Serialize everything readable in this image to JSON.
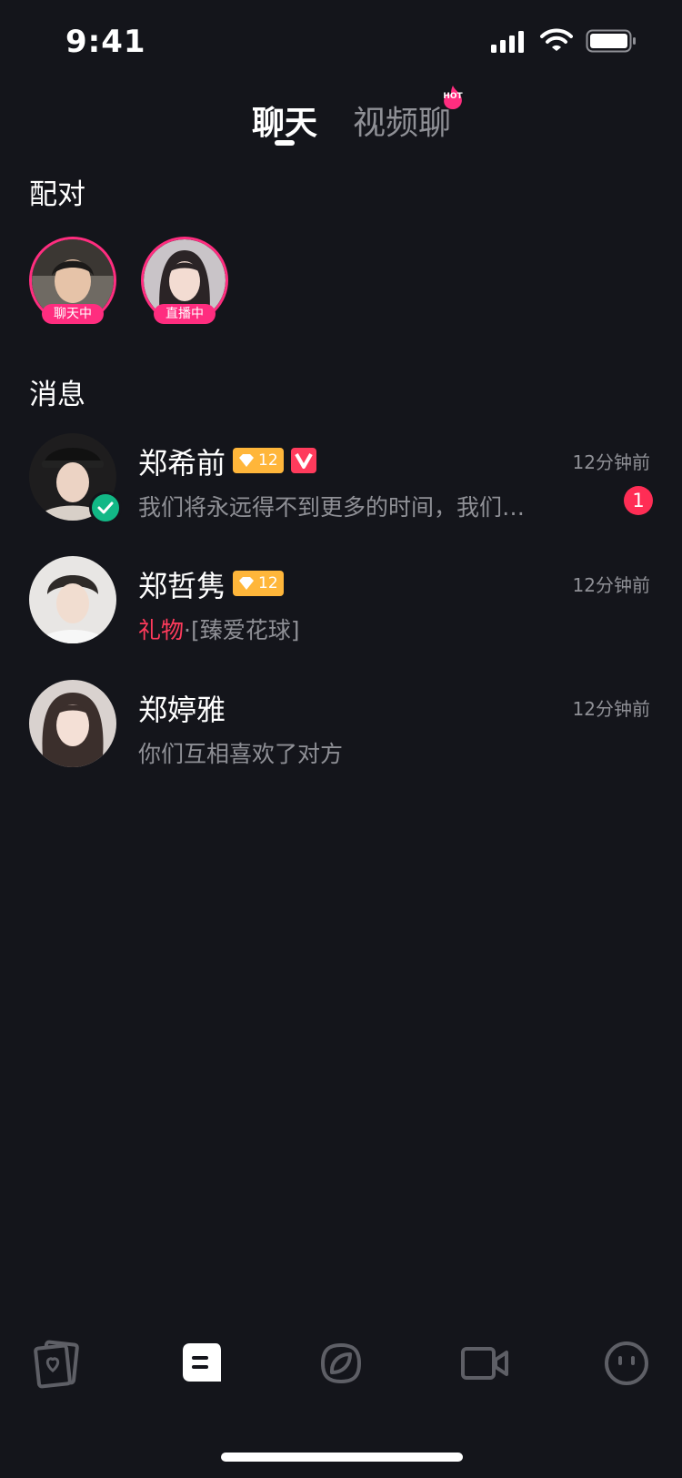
{
  "status_bar": {
    "time": "9:41"
  },
  "tabs": [
    {
      "label": "聊天",
      "active": true
    },
    {
      "label": "视频聊",
      "active": false,
      "badge": "HOT"
    }
  ],
  "match_section": {
    "title": "配对",
    "items": [
      {
        "tag": "聊天中"
      },
      {
        "tag": "直播中"
      }
    ]
  },
  "messages_section": {
    "title": "消息",
    "items": [
      {
        "name": "郑希前",
        "level": "12",
        "vip": true,
        "verified": true,
        "time": "12分钟前",
        "preview": "我们将永远得不到更多的时间，我们…",
        "unread": "1"
      },
      {
        "name": "郑哲隽",
        "level": "12",
        "vip": false,
        "verified": false,
        "time": "12分钟前",
        "preview_prefix": "礼物",
        "preview": "·[臻爱花球]"
      },
      {
        "name": "郑婷雅",
        "time": "12分钟前",
        "preview": "你们互相喜欢了对方"
      }
    ]
  },
  "bottom_nav": [
    {
      "icon": "cards-heart-icon",
      "active": false
    },
    {
      "icon": "chat-icon",
      "active": true
    },
    {
      "icon": "discover-icon",
      "active": false
    },
    {
      "icon": "video-call-icon",
      "active": false
    },
    {
      "icon": "profile-face-icon",
      "active": false
    }
  ],
  "colors": {
    "background": "#14151b",
    "accent": "#ff2d7f",
    "unread": "#ff2d55",
    "gold": "#ffb63a",
    "verified": "#12b886"
  }
}
